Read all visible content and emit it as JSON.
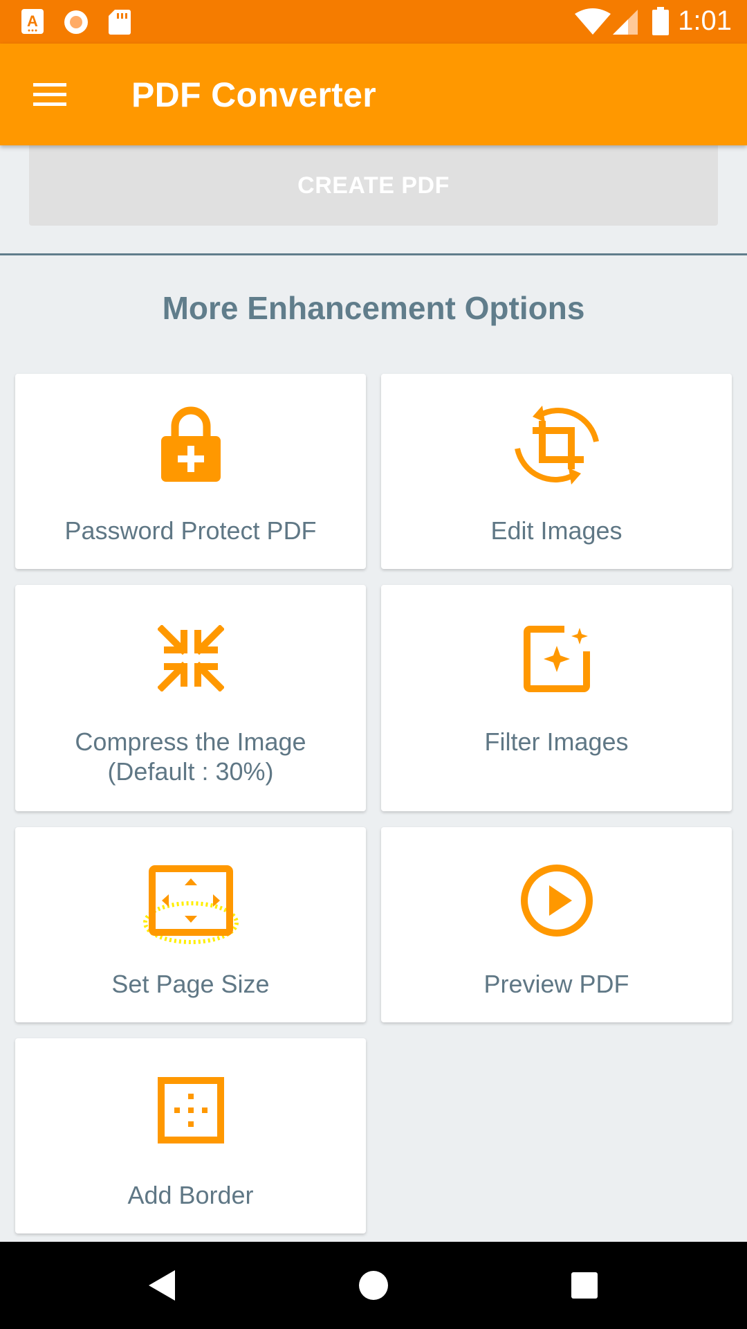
{
  "status_bar": {
    "time": "1:01",
    "icons": [
      "app-notification-icon",
      "circle-notification-icon",
      "sd-card-icon",
      "wifi-icon",
      "signal-icon",
      "battery-icon"
    ]
  },
  "app_bar": {
    "title": "PDF Converter",
    "menu_icon": "hamburger-menu-icon"
  },
  "create_button": {
    "label": "CREATE PDF"
  },
  "section": {
    "title": "More Enhancement Options"
  },
  "options": [
    {
      "label": "Password Protect PDF",
      "icon": "lock-plus-icon"
    },
    {
      "label": "Edit Images",
      "icon": "crop-rotate-icon"
    },
    {
      "label_line1": "Compress the Image",
      "label_line2": "(Default : 30%)",
      "icon": "compress-arrows-icon"
    },
    {
      "label": "Filter Images",
      "icon": "image-filter-icon"
    },
    {
      "label": "Set Page Size",
      "icon": "page-size-icon"
    },
    {
      "label": "Preview PDF",
      "icon": "play-circle-icon"
    },
    {
      "label": "Add Border",
      "icon": "border-inner-icon"
    }
  ],
  "colors": {
    "status_bar": "#F57C00",
    "app_bar": "#FF9800",
    "accent_icon": "#FF9800",
    "label_text": "#5F7785",
    "background": "#ECEFF1"
  },
  "nav_bar": {
    "icons": [
      "back-icon",
      "home-icon",
      "recents-icon"
    ]
  }
}
